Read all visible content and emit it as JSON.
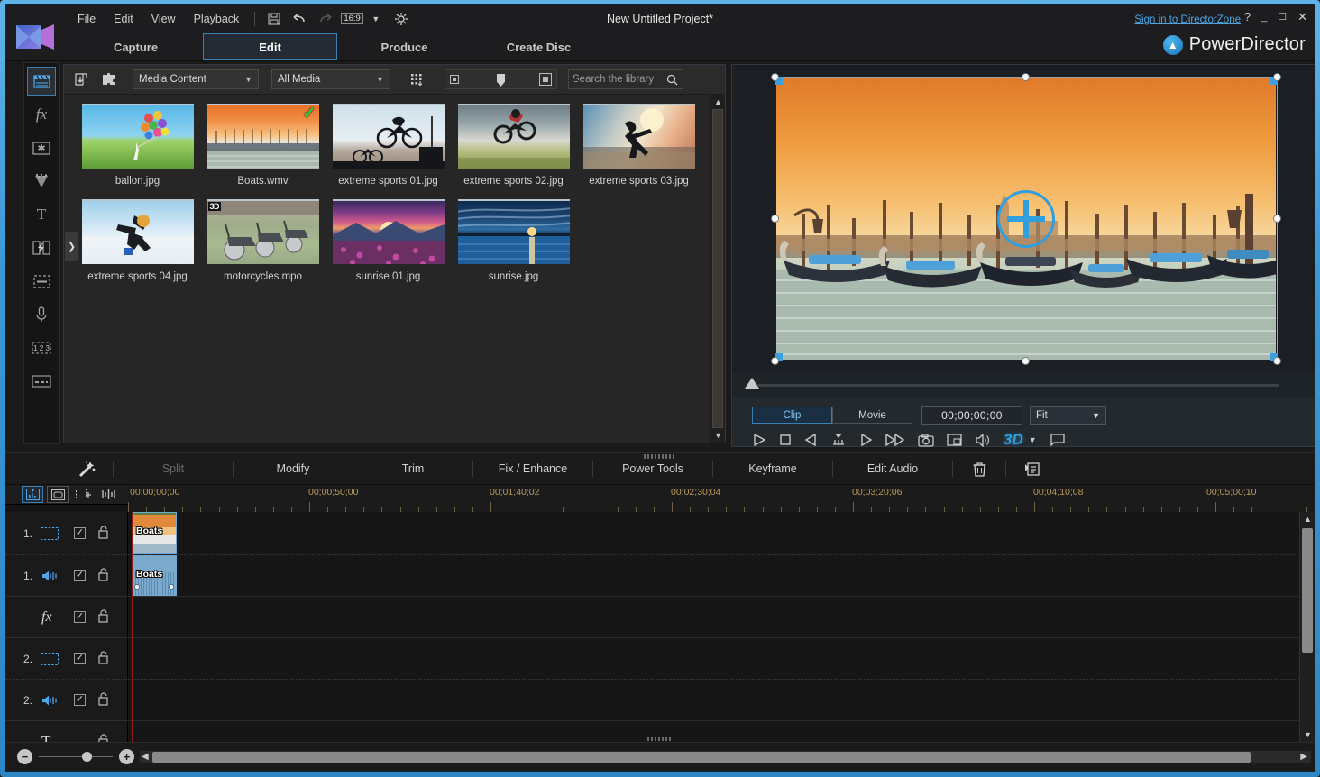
{
  "window": {
    "project_title": "New Untitled Project*",
    "directorzone_link": "Sign in to DirectorZone",
    "help": "?",
    "minimize": "—",
    "maximize": "❑",
    "close": "✕",
    "brand": "PowerDirector",
    "brand_icon": "up-arrow-circle-icon",
    "logo_icon": "powerdirector-logo-icon"
  },
  "menu": {
    "items": [
      "File",
      "Edit",
      "View",
      "Playback"
    ],
    "icons": [
      {
        "name": "save-icon",
        "glyph": "ὋE"
      },
      {
        "name": "undo-icon",
        "glyph": "↶"
      },
      {
        "name": "redo-icon",
        "glyph": "↷"
      },
      {
        "name": "aspect-ratio-icon",
        "glyph": "16:9"
      },
      {
        "name": "preferences-gear-icon",
        "glyph": "⚙"
      }
    ],
    "aspect_ratio": "16:9"
  },
  "modes": [
    {
      "label": "Capture",
      "active": false
    },
    {
      "label": "Edit",
      "active": true
    },
    {
      "label": "Produce",
      "active": false
    },
    {
      "label": "Create Disc",
      "active": false
    }
  ],
  "rail": [
    {
      "name": "media-room-icon",
      "glyph": "ἺC",
      "active": true
    },
    {
      "name": "effect-room-icon",
      "glyph": "fx",
      "active": false
    },
    {
      "name": "pip-objects-room-icon",
      "glyph": "✲",
      "active": false
    },
    {
      "name": "particle-room-icon",
      "glyph": "▼",
      "active": false
    },
    {
      "name": "title-room-icon",
      "glyph": "T",
      "active": false
    },
    {
      "name": "transition-room-icon",
      "glyph": "⚡",
      "active": false
    },
    {
      "name": "audio-mixing-room-icon",
      "glyph": "≡",
      "active": false
    },
    {
      "name": "voice-over-room-icon",
      "glyph": "Ἲ4",
      "active": false
    },
    {
      "name": "chapter-room-icon",
      "glyph": "123",
      "active": false
    },
    {
      "name": "subtitle-room-icon",
      "glyph": "––",
      "active": false
    }
  ],
  "library": {
    "toolbar": {
      "import_icon": "import-media-icon",
      "plugin_icon": "plugin-puzzle-icon",
      "grid_icon": "grid-view-icon",
      "content_select": "Media Content",
      "filter_select": "All Media",
      "size_small_icon": "small-thumbnail-icon",
      "size_large_icon": "large-thumbnail-icon",
      "search_placeholder": "Search the library",
      "search_value": "",
      "search_icon": "search-icon"
    },
    "collapse_icon": "chevron-right-icon",
    "items": [
      {
        "label": "ballon.jpg",
        "kind": "image",
        "checked": false,
        "is3d": false
      },
      {
        "label": "Boats.wmv",
        "kind": "video",
        "checked": true,
        "is3d": false
      },
      {
        "label": "extreme sports 01.jpg",
        "kind": "image",
        "checked": false,
        "is3d": false
      },
      {
        "label": "extreme sports 02.jpg",
        "kind": "image",
        "checked": false,
        "is3d": false
      },
      {
        "label": "extreme sports 03.jpg",
        "kind": "image",
        "checked": false,
        "is3d": false
      },
      {
        "label": "extreme sports 04.jpg",
        "kind": "image",
        "checked": false,
        "is3d": false
      },
      {
        "label": "motorcycles.mpo",
        "kind": "image",
        "checked": false,
        "is3d": true
      },
      {
        "label": "sunrise 01.jpg",
        "kind": "image",
        "checked": false,
        "is3d": false
      },
      {
        "label": "sunrise.jpg",
        "kind": "image",
        "checked": false,
        "is3d": false
      }
    ]
  },
  "preview": {
    "clip_tab": "Clip",
    "movie_tab": "Movie",
    "active_tab": "Clip",
    "timecode": "00;00;00;00",
    "zoom_select": "Fit",
    "controls": [
      {
        "name": "play-button",
        "glyph": "▷"
      },
      {
        "name": "stop-button",
        "glyph": "□"
      },
      {
        "name": "previous-frame-button",
        "glyph": "◁"
      },
      {
        "name": "step-marker-button",
        "glyph": "⚓"
      },
      {
        "name": "next-frame-button",
        "glyph": "▷"
      },
      {
        "name": "fast-forward-button",
        "glyph": "▷▷"
      },
      {
        "name": "snapshot-button",
        "glyph": "὏7"
      },
      {
        "name": "pip-window-button",
        "glyph": "◳"
      },
      {
        "name": "volume-button",
        "glyph": "ὐA"
      },
      {
        "name": "3d-mode-button",
        "glyph": "3D"
      },
      {
        "name": "3d-dropdown-button",
        "glyph": "▾"
      },
      {
        "name": "undock-preview-button",
        "glyph": "↵"
      }
    ],
    "image_description": "Venice gondolas at sunset"
  },
  "edit_toolbar": [
    {
      "label": "",
      "name": "magic-tools-button",
      "icon": "magic-wand-icon",
      "disabled": false
    },
    {
      "label": "Split",
      "name": "split-button",
      "disabled": true
    },
    {
      "label": "Modify",
      "name": "modify-button",
      "disabled": false
    },
    {
      "label": "Trim",
      "name": "trim-button",
      "disabled": false
    },
    {
      "label": "Fix / Enhance",
      "name": "fix-enhance-button",
      "disabled": false
    },
    {
      "label": "Power Tools",
      "name": "power-tools-button",
      "disabled": false
    },
    {
      "label": "Keyframe",
      "name": "keyframe-button",
      "disabled": false
    },
    {
      "label": "Edit Audio",
      "name": "edit-audio-button",
      "disabled": false
    },
    {
      "label": "",
      "name": "delete-button",
      "icon": "trash-icon",
      "disabled": false
    },
    {
      "label": "",
      "name": "notes-button",
      "icon": "notes-icon",
      "disabled": false
    }
  ],
  "timeline": {
    "toolbar": [
      {
        "name": "timeline-view-button",
        "glyph": "░",
        "active": true,
        "boxed": false
      },
      {
        "name": "storyboard-view-button",
        "glyph": "▣",
        "active": false,
        "boxed": true
      },
      {
        "name": "track-manager-button",
        "glyph": "⊞",
        "active": false,
        "boxed": false
      },
      {
        "name": "sync-tracks-button",
        "glyph": "⎯|⎯",
        "active": false,
        "boxed": false
      }
    ],
    "ruler_labels": [
      "00;00;00;00",
      "00;00;50;00",
      "00;01;40;02",
      "00;02;30;04",
      "00;03;20;06",
      "00;04;10;08",
      "00;05;00;10"
    ],
    "tracks": [
      {
        "num": "1.",
        "type_icon": "video-track-icon",
        "enabled": true,
        "locked": false,
        "clip": "Boats",
        "clip_kind": "video"
      },
      {
        "num": "1.",
        "type_icon": "audio-track-icon",
        "enabled": true,
        "locked": false,
        "clip": "Boats",
        "clip_kind": "audio"
      },
      {
        "num": "",
        "type_icon": "effect-track-icon",
        "enabled": true,
        "locked": false,
        "clip": "",
        "clip_kind": ""
      },
      {
        "num": "2.",
        "type_icon": "video-track-icon",
        "enabled": true,
        "locked": false,
        "clip": "",
        "clip_kind": ""
      },
      {
        "num": "2.",
        "type_icon": "audio-track-icon",
        "enabled": true,
        "locked": false,
        "clip": "",
        "clip_kind": ""
      },
      {
        "num": "",
        "type_icon": "title-track-icon",
        "enabled": null,
        "locked": false,
        "clip": "",
        "clip_kind": ""
      }
    ],
    "zoom_out_icon": "zoom-out-icon",
    "zoom_in_icon": "zoom-in-icon",
    "scroll_left_icon": "scroll-left-icon",
    "scroll_right_icon": "scroll-right-icon"
  },
  "colors": {
    "accent_blue": "#3c7fb1",
    "highlight_blue": "#4da6e8",
    "window_border": "#3a97d6",
    "ruler_text": "#b99b57",
    "playhead": "#8c1f1f",
    "check_green": "#2ecc40"
  }
}
